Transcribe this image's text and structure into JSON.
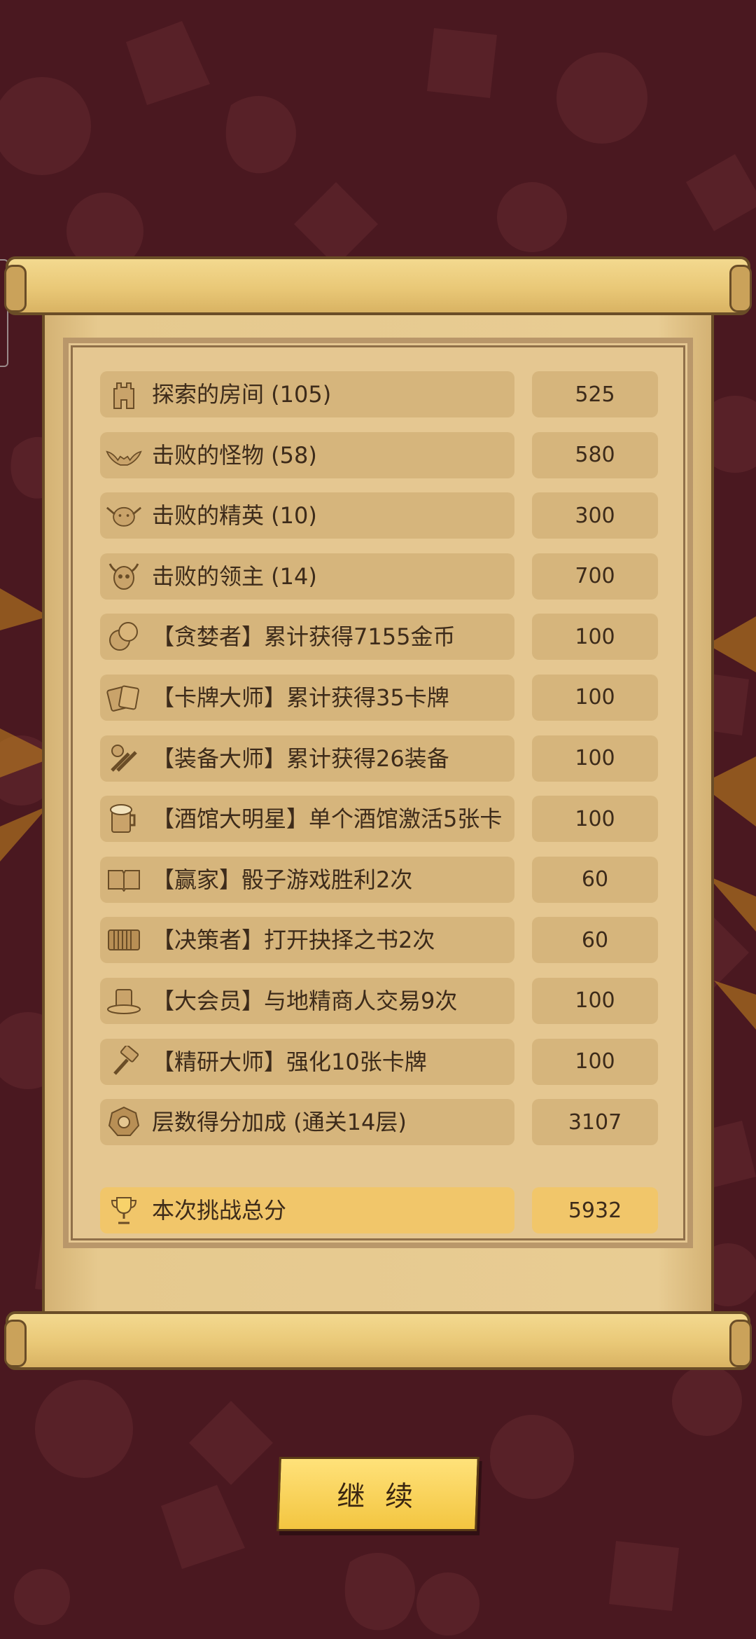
{
  "rows": [
    {
      "icon": "tower-icon",
      "label": "探索的房间 (105)",
      "value": "525"
    },
    {
      "icon": "bat-icon",
      "label": "击败的怪物 (58)",
      "value": "580"
    },
    {
      "icon": "demon-icon",
      "label": "击败的精英 (10)",
      "value": "300"
    },
    {
      "icon": "horned-skull-icon",
      "label": "击败的领主 (14)",
      "value": "700"
    },
    {
      "icon": "coins-icon",
      "label": "【贪婪者】累计获得7155金币",
      "value": "100"
    },
    {
      "icon": "cards-icon",
      "label": "【卡牌大师】累计获得35卡牌",
      "value": "100"
    },
    {
      "icon": "equipment-icon",
      "label": "【装备大师】累计获得26装备",
      "value": "100"
    },
    {
      "icon": "beer-mug-icon",
      "label": "【酒馆大明星】单个酒馆激活5张卡",
      "value": "100"
    },
    {
      "icon": "open-book-icon",
      "label": "【赢家】骰子游戏胜利2次",
      "value": "60"
    },
    {
      "icon": "closed-book-icon",
      "label": "【决策者】打开抉择之书2次",
      "value": "60"
    },
    {
      "icon": "top-hat-icon",
      "label": "【大会员】与地精商人交易9次",
      "value": "100"
    },
    {
      "icon": "hammer-icon",
      "label": "【精研大师】强化10张卡牌",
      "value": "100"
    },
    {
      "icon": "floor-badge-icon",
      "label": "层数得分加成 (通关14层)",
      "value": "3107"
    }
  ],
  "total": {
    "icon": "trophy-icon",
    "label": "本次挑战总分",
    "value": "5932"
  },
  "continue_button": "继 续",
  "colors": {
    "background": "#4a1820",
    "parchment": "#e5c791",
    "row": "#d6b57c",
    "highlight": "#f1c66a",
    "button": "#f3c540"
  }
}
